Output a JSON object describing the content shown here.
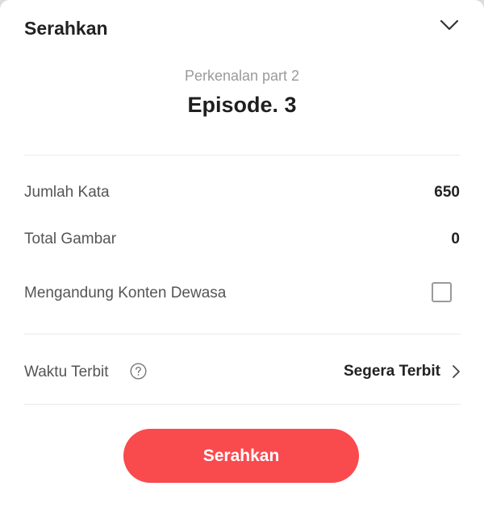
{
  "header": {
    "title": "Serahkan",
    "collapse_icon": "chevron-down-icon"
  },
  "episode": {
    "subtitle": "Perkenalan part 2",
    "title": "Episode. 3"
  },
  "stats": {
    "word_count_label": "Jumlah Kata",
    "word_count_value": "650",
    "image_count_label": "Total Gambar",
    "image_count_value": "0"
  },
  "mature_content": {
    "label": "Mengandung Konten Dewasa",
    "checked": false
  },
  "publish_time": {
    "label": "Waktu Terbit",
    "help_icon": "question-circle-icon",
    "value": "Segera Terbit",
    "chevron_icon": "chevron-right-icon"
  },
  "submit": {
    "label": "Serahkan"
  },
  "colors": {
    "accent": "#f94a4e",
    "text_primary": "#222222",
    "text_secondary": "#555555",
    "text_muted": "#9a9a9a",
    "divider": "#ebebeb"
  }
}
